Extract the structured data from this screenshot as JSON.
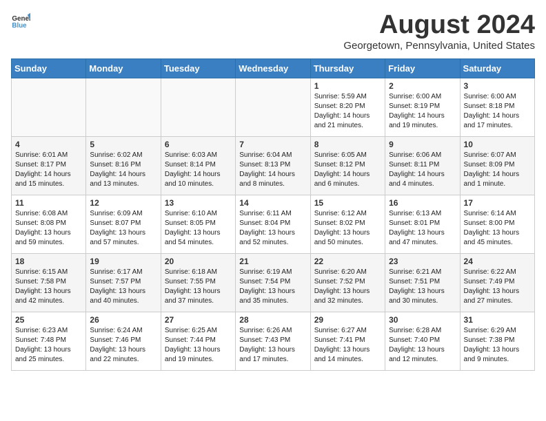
{
  "logo": {
    "line1": "General",
    "line2": "Blue"
  },
  "title": "August 2024",
  "location": "Georgetown, Pennsylvania, United States",
  "days_header": [
    "Sunday",
    "Monday",
    "Tuesday",
    "Wednesday",
    "Thursday",
    "Friday",
    "Saturday"
  ],
  "weeks": [
    [
      {
        "day": "",
        "info": ""
      },
      {
        "day": "",
        "info": ""
      },
      {
        "day": "",
        "info": ""
      },
      {
        "day": "",
        "info": ""
      },
      {
        "day": "1",
        "info": "Sunrise: 5:59 AM\nSunset: 8:20 PM\nDaylight: 14 hours\nand 21 minutes."
      },
      {
        "day": "2",
        "info": "Sunrise: 6:00 AM\nSunset: 8:19 PM\nDaylight: 14 hours\nand 19 minutes."
      },
      {
        "day": "3",
        "info": "Sunrise: 6:00 AM\nSunset: 8:18 PM\nDaylight: 14 hours\nand 17 minutes."
      }
    ],
    [
      {
        "day": "4",
        "info": "Sunrise: 6:01 AM\nSunset: 8:17 PM\nDaylight: 14 hours\nand 15 minutes."
      },
      {
        "day": "5",
        "info": "Sunrise: 6:02 AM\nSunset: 8:16 PM\nDaylight: 14 hours\nand 13 minutes."
      },
      {
        "day": "6",
        "info": "Sunrise: 6:03 AM\nSunset: 8:14 PM\nDaylight: 14 hours\nand 10 minutes."
      },
      {
        "day": "7",
        "info": "Sunrise: 6:04 AM\nSunset: 8:13 PM\nDaylight: 14 hours\nand 8 minutes."
      },
      {
        "day": "8",
        "info": "Sunrise: 6:05 AM\nSunset: 8:12 PM\nDaylight: 14 hours\nand 6 minutes."
      },
      {
        "day": "9",
        "info": "Sunrise: 6:06 AM\nSunset: 8:11 PM\nDaylight: 14 hours\nand 4 minutes."
      },
      {
        "day": "10",
        "info": "Sunrise: 6:07 AM\nSunset: 8:09 PM\nDaylight: 14 hours\nand 1 minute."
      }
    ],
    [
      {
        "day": "11",
        "info": "Sunrise: 6:08 AM\nSunset: 8:08 PM\nDaylight: 13 hours\nand 59 minutes."
      },
      {
        "day": "12",
        "info": "Sunrise: 6:09 AM\nSunset: 8:07 PM\nDaylight: 13 hours\nand 57 minutes."
      },
      {
        "day": "13",
        "info": "Sunrise: 6:10 AM\nSunset: 8:05 PM\nDaylight: 13 hours\nand 54 minutes."
      },
      {
        "day": "14",
        "info": "Sunrise: 6:11 AM\nSunset: 8:04 PM\nDaylight: 13 hours\nand 52 minutes."
      },
      {
        "day": "15",
        "info": "Sunrise: 6:12 AM\nSunset: 8:02 PM\nDaylight: 13 hours\nand 50 minutes."
      },
      {
        "day": "16",
        "info": "Sunrise: 6:13 AM\nSunset: 8:01 PM\nDaylight: 13 hours\nand 47 minutes."
      },
      {
        "day": "17",
        "info": "Sunrise: 6:14 AM\nSunset: 8:00 PM\nDaylight: 13 hours\nand 45 minutes."
      }
    ],
    [
      {
        "day": "18",
        "info": "Sunrise: 6:15 AM\nSunset: 7:58 PM\nDaylight: 13 hours\nand 42 minutes."
      },
      {
        "day": "19",
        "info": "Sunrise: 6:17 AM\nSunset: 7:57 PM\nDaylight: 13 hours\nand 40 minutes."
      },
      {
        "day": "20",
        "info": "Sunrise: 6:18 AM\nSunset: 7:55 PM\nDaylight: 13 hours\nand 37 minutes."
      },
      {
        "day": "21",
        "info": "Sunrise: 6:19 AM\nSunset: 7:54 PM\nDaylight: 13 hours\nand 35 minutes."
      },
      {
        "day": "22",
        "info": "Sunrise: 6:20 AM\nSunset: 7:52 PM\nDaylight: 13 hours\nand 32 minutes."
      },
      {
        "day": "23",
        "info": "Sunrise: 6:21 AM\nSunset: 7:51 PM\nDaylight: 13 hours\nand 30 minutes."
      },
      {
        "day": "24",
        "info": "Sunrise: 6:22 AM\nSunset: 7:49 PM\nDaylight: 13 hours\nand 27 minutes."
      }
    ],
    [
      {
        "day": "25",
        "info": "Sunrise: 6:23 AM\nSunset: 7:48 PM\nDaylight: 13 hours\nand 25 minutes."
      },
      {
        "day": "26",
        "info": "Sunrise: 6:24 AM\nSunset: 7:46 PM\nDaylight: 13 hours\nand 22 minutes."
      },
      {
        "day": "27",
        "info": "Sunrise: 6:25 AM\nSunset: 7:44 PM\nDaylight: 13 hours\nand 19 minutes."
      },
      {
        "day": "28",
        "info": "Sunrise: 6:26 AM\nSunset: 7:43 PM\nDaylight: 13 hours\nand 17 minutes."
      },
      {
        "day": "29",
        "info": "Sunrise: 6:27 AM\nSunset: 7:41 PM\nDaylight: 13 hours\nand 14 minutes."
      },
      {
        "day": "30",
        "info": "Sunrise: 6:28 AM\nSunset: 7:40 PM\nDaylight: 13 hours\nand 12 minutes."
      },
      {
        "day": "31",
        "info": "Sunrise: 6:29 AM\nSunset: 7:38 PM\nDaylight: 13 hours\nand 9 minutes."
      }
    ]
  ]
}
